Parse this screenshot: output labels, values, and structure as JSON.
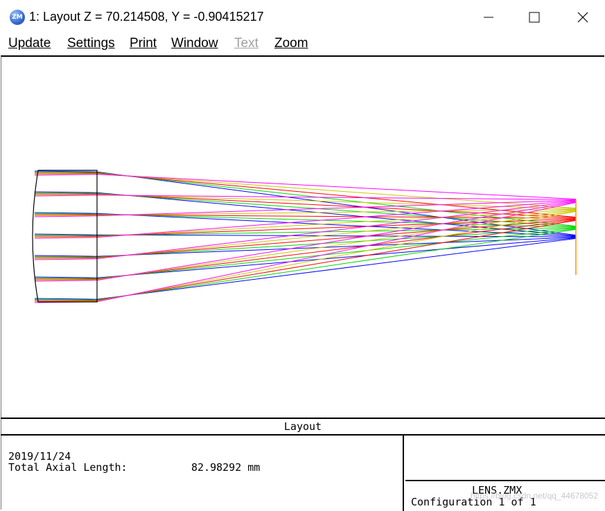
{
  "window": {
    "icon_label": "ZM",
    "title": "1: Layout Z = 70.214508, Y = -0.90415217",
    "buttons": [
      "minimize-icon",
      "maximize-icon",
      "close-icon"
    ]
  },
  "menu": [
    {
      "label": "Update",
      "enabled": true
    },
    {
      "label": "Settings",
      "enabled": true
    },
    {
      "label": "Print",
      "enabled": true
    },
    {
      "label": "Window",
      "enabled": true
    },
    {
      "label": "Text",
      "enabled": false
    },
    {
      "label": "Zoom",
      "enabled": true
    }
  ],
  "layout_plot": {
    "ray_colors": [
      "#0000ff",
      "#00d800",
      "#ff0000",
      "#c8c800",
      "#ff00ff"
    ]
  },
  "legend": {
    "title": "Layout",
    "date": "2019/11/24",
    "axial_length_label": "Total Axial Length:",
    "axial_length_value": "82.98292 mm",
    "file_name": "LENS.ZMX",
    "configuration": "Configuration 1 of 1",
    "watermark": "https://blog.csdn.net/qq_44678052"
  }
}
